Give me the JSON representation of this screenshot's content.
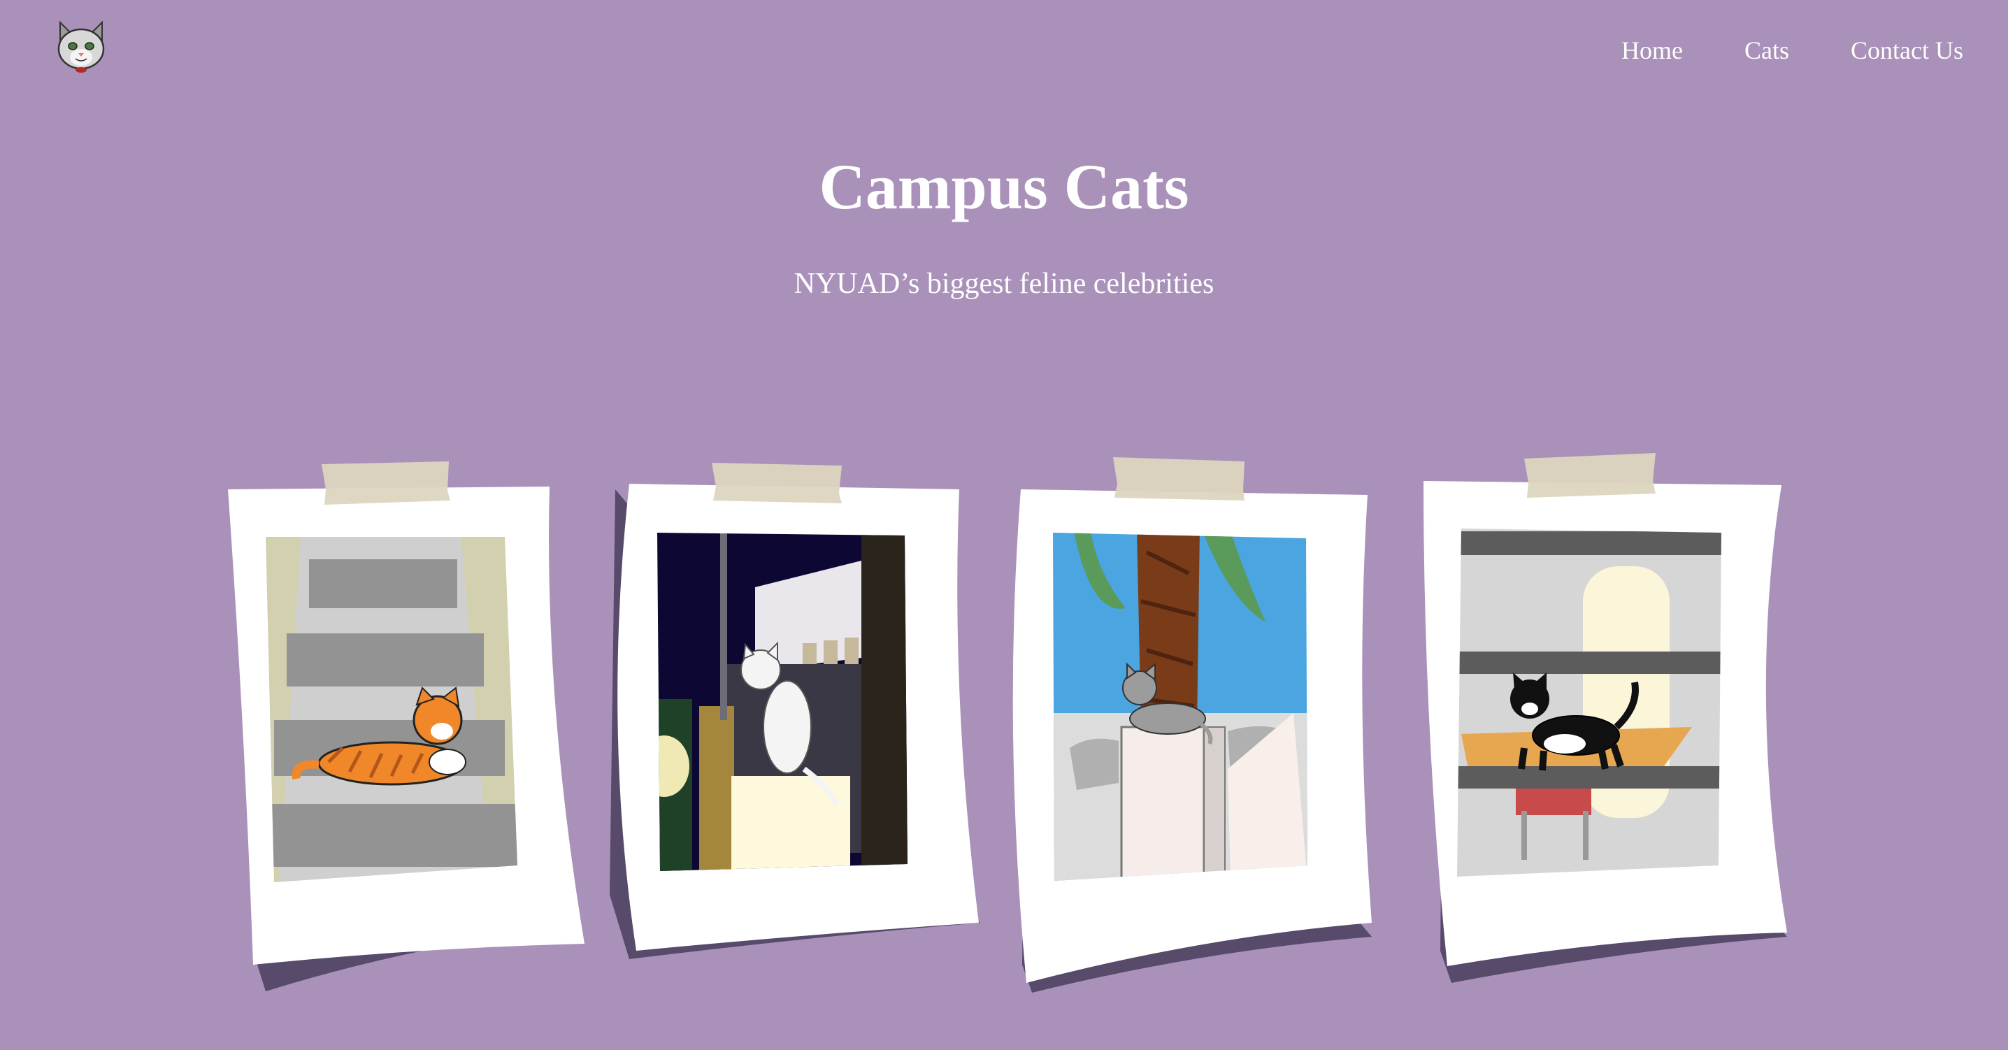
{
  "logo": {
    "icon": "cat-face-icon"
  },
  "nav": {
    "items": [
      {
        "label": "Home",
        "name": "nav-home-link"
      },
      {
        "label": "Cats",
        "name": "nav-cats-link"
      },
      {
        "label": "Contact Us",
        "name": "nav-contact-link"
      }
    ]
  },
  "hero": {
    "title": "Campus Cats",
    "subtitle": "NYUAD’s biggest feline celebrities"
  },
  "colors": {
    "background": "#a991b9",
    "polaroid_frame": "#ffffff",
    "polaroid_shadow": "#574a6b",
    "tape": "#dcd6bf",
    "text": "#ffffff"
  },
  "polaroids": [
    {
      "name": "cat-photo-orange-tabby-stairs",
      "cat": "orange tabby cat lying on stairs"
    },
    {
      "name": "cat-photo-white-cat-night",
      "cat": "white cat sitting at night"
    },
    {
      "name": "cat-photo-grey-tabby-palm",
      "cat": "grey tabby cat under palm tree"
    },
    {
      "name": "cat-photo-tuxedo-cat-table",
      "cat": "black and white tuxedo cat on railing"
    }
  ]
}
